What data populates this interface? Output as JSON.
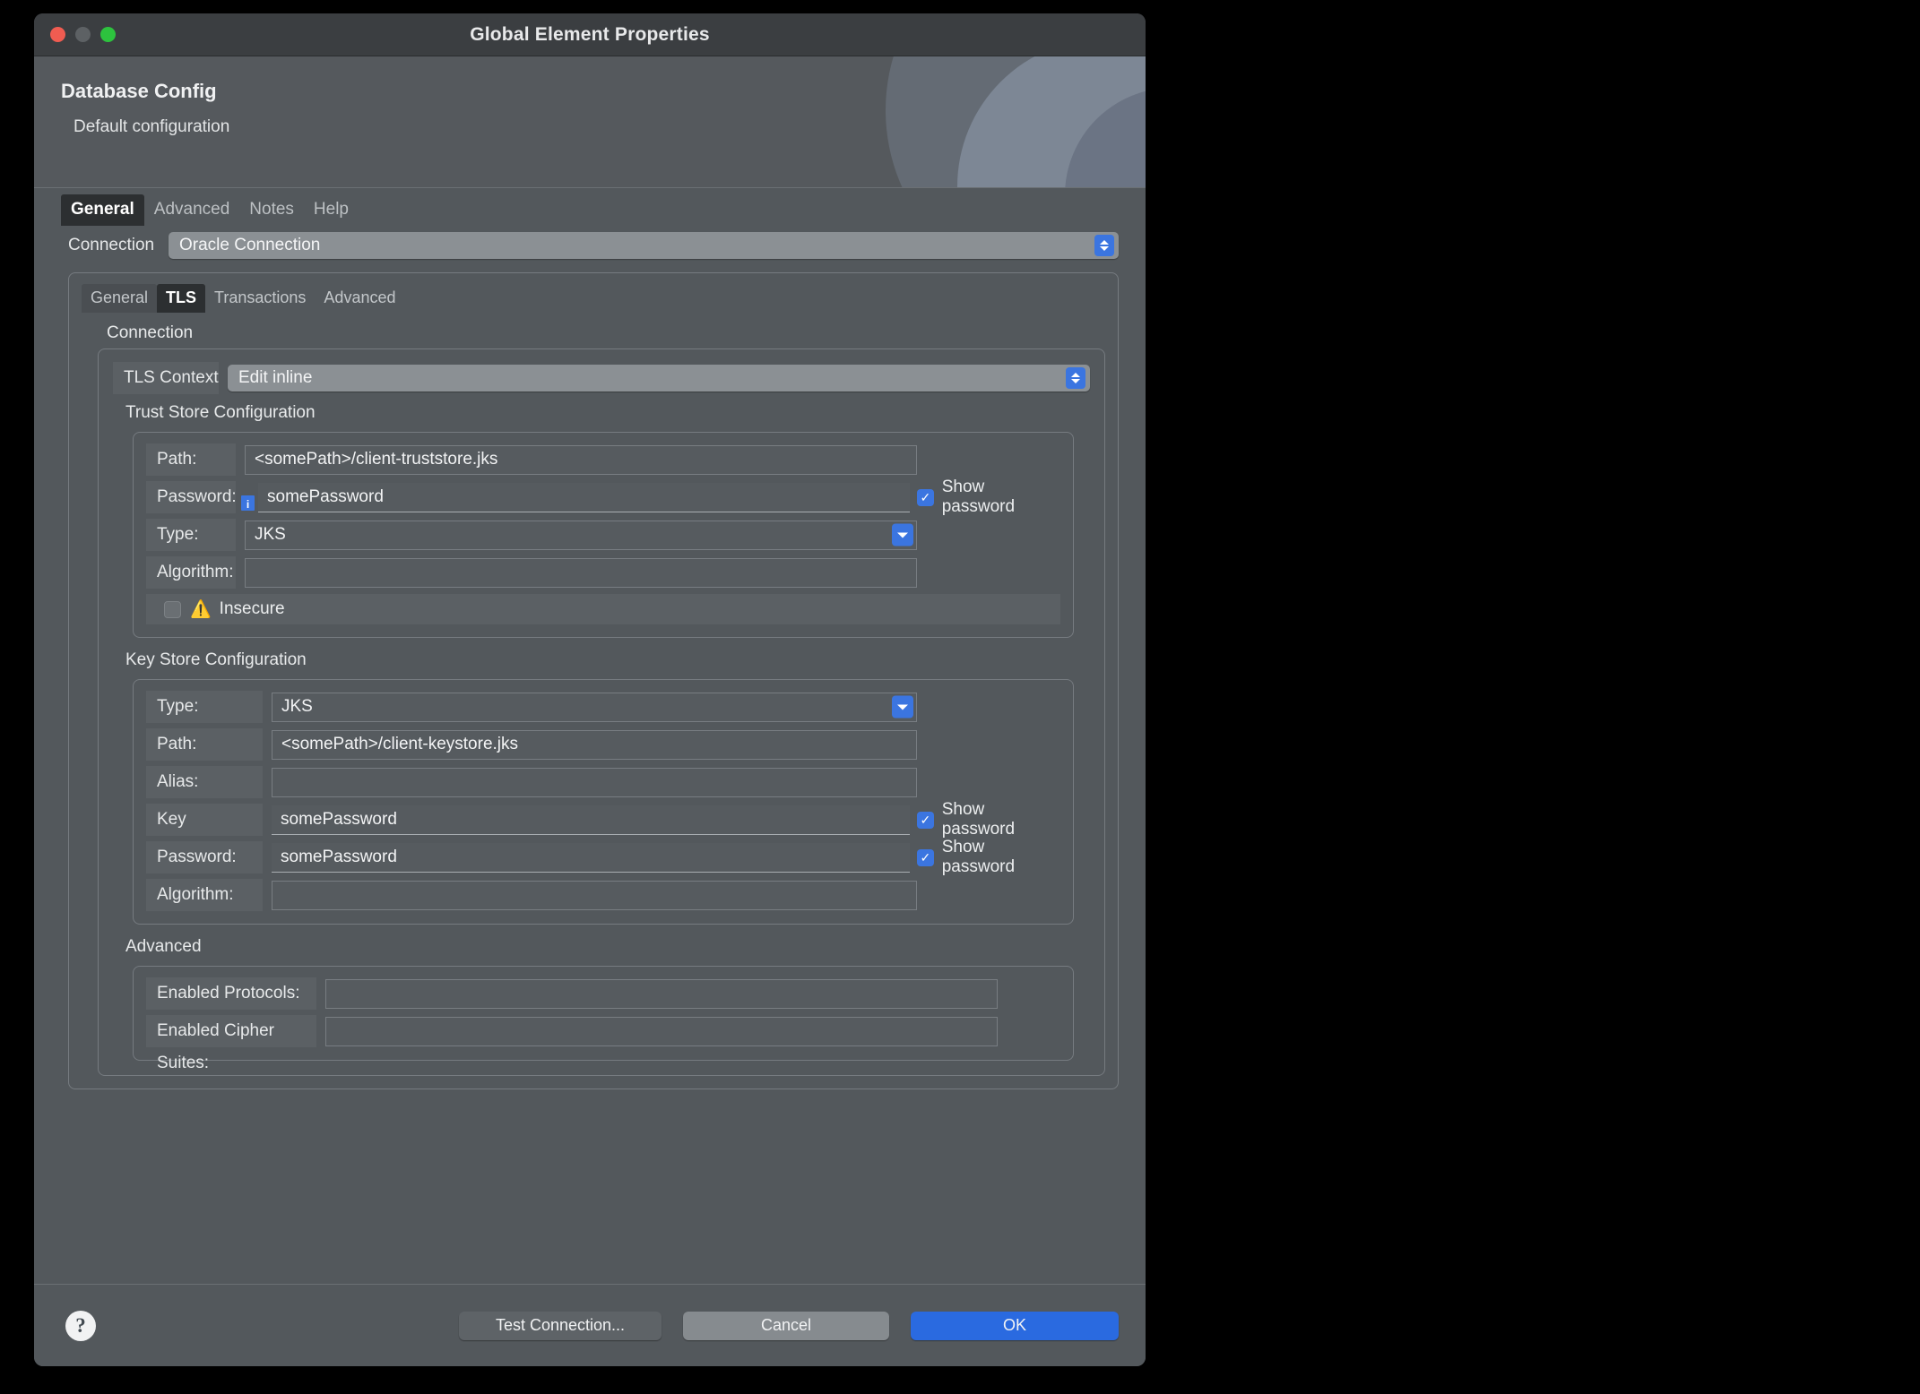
{
  "window": {
    "title": "Global Element Properties",
    "traffic_lights": [
      "close-red",
      "minimize-yellow",
      "zoom-green"
    ]
  },
  "header": {
    "title": "Database Config",
    "subtitle": "Default configuration"
  },
  "outer_tabs": [
    {
      "label": "General",
      "active": true
    },
    {
      "label": "Advanced",
      "active": false
    },
    {
      "label": "Notes",
      "active": false
    },
    {
      "label": "Help",
      "active": false
    }
  ],
  "connection": {
    "label": "Connection",
    "value": "Oracle Connection"
  },
  "inner_tabs": [
    {
      "label": "General",
      "active": false
    },
    {
      "label": "TLS",
      "active": true
    },
    {
      "label": "Transactions",
      "active": false
    },
    {
      "label": "Advanced",
      "active": false
    }
  ],
  "connection_group": {
    "title": "Connection",
    "tls_context": {
      "label": "TLS Context",
      "value": "Edit inline"
    }
  },
  "trust_store": {
    "title": "Trust Store Configuration",
    "path": {
      "label": "Path:",
      "value": "<somePath>/client-truststore.jks"
    },
    "password": {
      "label": "Password:",
      "value": "somePassword",
      "info_badge": "i",
      "show_password_label": "Show password",
      "show_password_checked": true
    },
    "type": {
      "label": "Type:",
      "value": "JKS"
    },
    "algorithm": {
      "label": "Algorithm:",
      "value": ""
    },
    "insecure": {
      "label": "Insecure",
      "checked": false,
      "icon": "warning-triangle"
    }
  },
  "key_store": {
    "title": "Key Store Configuration",
    "type": {
      "label": "Type:",
      "value": "JKS"
    },
    "path": {
      "label": "Path:",
      "value": "<somePath>/client-keystore.jks"
    },
    "alias": {
      "label": "Alias:",
      "value": ""
    },
    "key_password": {
      "label": "Key Password:",
      "value": "somePassword",
      "show_password_label": "Show password",
      "show_password_checked": true
    },
    "password": {
      "label": "Password:",
      "value": "somePassword",
      "show_password_label": "Show password",
      "show_password_checked": true
    },
    "algorithm": {
      "label": "Algorithm:",
      "value": ""
    }
  },
  "advanced": {
    "title": "Advanced",
    "enabled_protocols": {
      "label": "Enabled Protocols:",
      "value": ""
    },
    "enabled_cipher_suites": {
      "label": "Enabled Cipher Suites:",
      "value": ""
    }
  },
  "footer": {
    "help_icon": "?",
    "test_connection": "Test Connection...",
    "cancel": "Cancel",
    "ok": "OK"
  },
  "colors": {
    "accent_blue": "#3b75e0",
    "ok_button": "#2a6ae0",
    "window_bg": "#53585c",
    "titlebar_bg": "#3b3e41"
  }
}
